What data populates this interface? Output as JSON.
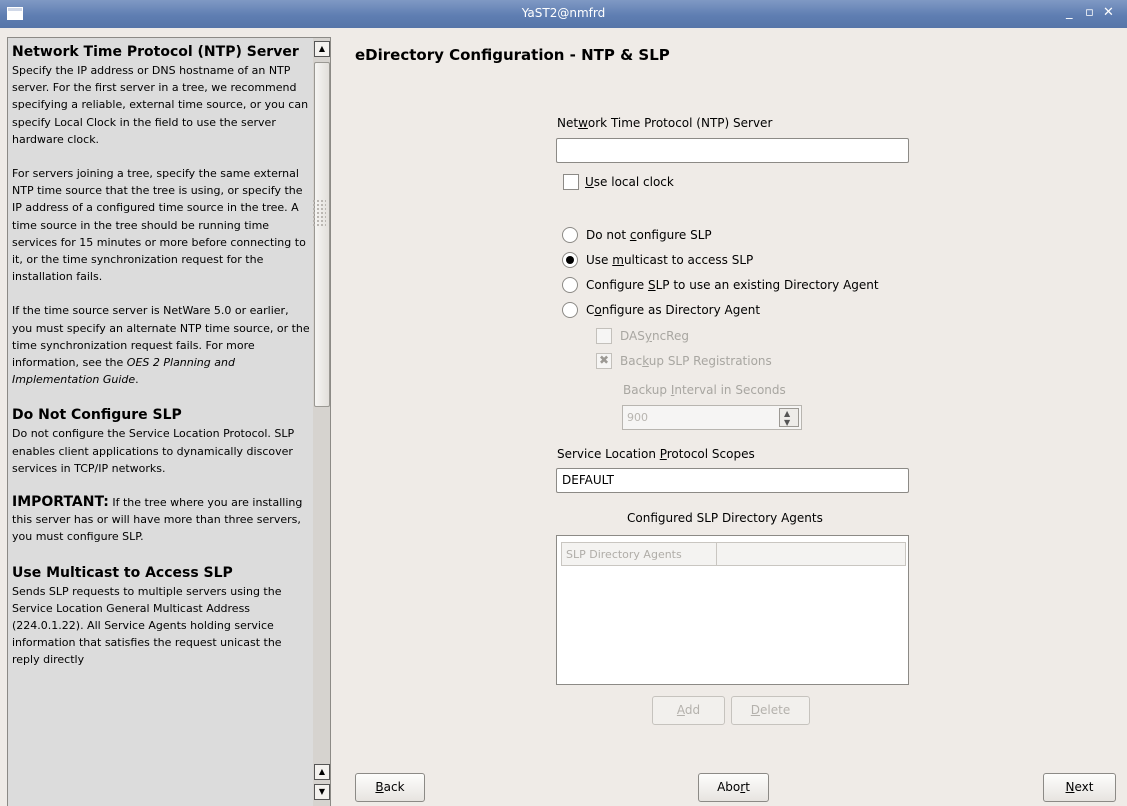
{
  "window": {
    "title": "YaST2@nmfrd",
    "controls": "_ ▫ ✕"
  },
  "help": {
    "h1": "Network Time Protocol (NTP) Server",
    "p1": "Specify the IP address or DNS hostname of an NTP server. For the first server in a tree, we recommend specifying a reliable, external time source, or you can specify Local Clock in the field to use the server hardware clock.",
    "p2": "For servers joining a tree, specify the same external NTP time source that the tree is using, or specify the IP address of a configured time source in the tree. A time source in the tree should be running time services for 15 minutes or more before connecting to it, or the time synchronization request for the installation fails.",
    "p3": "If the time source server is NetWare 5.0 or earlier, you must specify an alternate NTP time source, or the time synchronization request fails. For more information, see the",
    "p3_link": "OES 2 Planning and Implementation Guide",
    "h2": "Do Not Configure SLP",
    "p4": "Do not configure the Service Location Protocol. SLP enables client applications to dynamically discover services in TCP/IP networks.",
    "important_label": "IMPORTANT:",
    "p5": "If the tree where you are installing this server has or will have more than three servers, you must configure SLP.",
    "h3": "Use Multicast to Access SLP",
    "p6": "Sends SLP requests to multiple servers using the Service Location General Multicast Address (224.0.1.22). All Service Agents holding service information that satisfies the request unicast the reply directly"
  },
  "main": {
    "heading": "eDirectory Configuration - NTP & SLP",
    "ntp_label_pre": "Net",
    "ntp_label_acc": "w",
    "ntp_label_post": "ork Time Protocol (NTP) Server",
    "ntp_value": "",
    "local_clock_acc": "U",
    "local_clock_rest": "se local clock",
    "radios": [
      {
        "pre": "Do not ",
        "acc": "c",
        "post": "onfigure SLP"
      },
      {
        "pre": "Use ",
        "acc": "m",
        "post": "ulticast to access SLP"
      },
      {
        "pre": "Configure ",
        "acc": "S",
        "post": "LP to use an existing Directory Agent"
      },
      {
        "pre": "C",
        "acc": "o",
        "post": "nfigure as Directory Agent"
      }
    ],
    "dasyncreg_pre": "DAS",
    "dasyncreg_acc": "y",
    "dasyncreg_post": "ncReg",
    "backup_pre": "Bac",
    "backup_acc": "k",
    "backup_post": "up SLP Registrations",
    "interval_pre": "Backup ",
    "interval_acc": "I",
    "interval_post": "nterval in Seconds",
    "interval_value": "900",
    "scopes_pre": "Service Location ",
    "scopes_acc": "P",
    "scopes_post": "rotocol Scopes",
    "scopes_value": "DEFAULT",
    "agents_label": "Configured SLP Directory Agents",
    "agents_col": "SLP Directory Agents",
    "add_acc": "A",
    "add_rest": "dd",
    "delete_acc": "D",
    "delete_rest": "elete"
  },
  "footer": {
    "back_acc": "B",
    "back_rest": "ack",
    "abort_pre": "Abo",
    "abort_acc": "r",
    "abort_post": "t",
    "next_acc": "N",
    "next_rest": "ext"
  }
}
